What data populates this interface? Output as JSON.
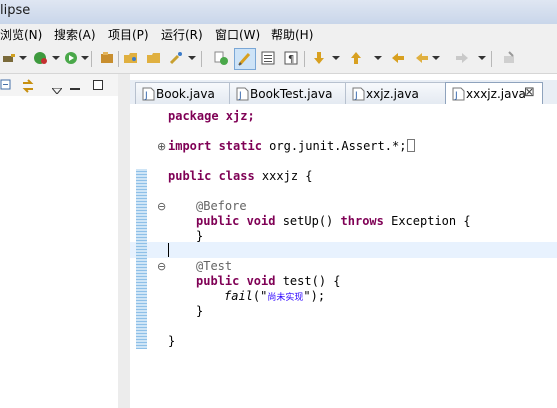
{
  "window": {
    "title": "lipse"
  },
  "menu": [
    "浏览(N)",
    "搜索(A)",
    "项目(P)",
    "运行(R)",
    "窗口(W)",
    "帮助(H)"
  ],
  "toolbar_icons": [
    "external-tools-icon",
    "run-icon",
    "open-type-icon",
    "open-folder-icon",
    "search-icon",
    "new-class-icon",
    "highlight-icon",
    "show-source-icon",
    "whitespace-icon",
    "next-annotation-icon",
    "prev-annotation-icon",
    "last-edit-icon",
    "back-icon",
    "forward-icon",
    "pin-editor-icon"
  ],
  "tabs": [
    {
      "label": "Book.java",
      "active": false
    },
    {
      "label": "BookTest.java",
      "active": false
    },
    {
      "label": "xxjz.java",
      "active": false
    },
    {
      "label": "xxxjz.java",
      "active": true
    }
  ],
  "code": {
    "l1": "package xjz;",
    "l2_kw": "import static",
    "l2_rest": " org.junit.Assert.*;",
    "l3_kw": "public class",
    "l3_rest": " xxxjz {",
    "l4": "@Before",
    "l5_kw1": "public void",
    "l5_mid": " setUp() ",
    "l5_kw2": "throws",
    "l5_rest": " Exception {",
    "l6": "}",
    "l7": "@Test",
    "l8_kw": "public void",
    "l8_rest": " test() {",
    "l9_fn": "fail",
    "l9_open": "(\"",
    "l9_str": "尚未实现",
    "l9_close": "\");",
    "l10": "}",
    "l11": "}"
  },
  "colors": {
    "keyword": "#7f0055",
    "annotation": "#646464",
    "string": "#2a00ff",
    "current_line": "#e8f2fe"
  }
}
